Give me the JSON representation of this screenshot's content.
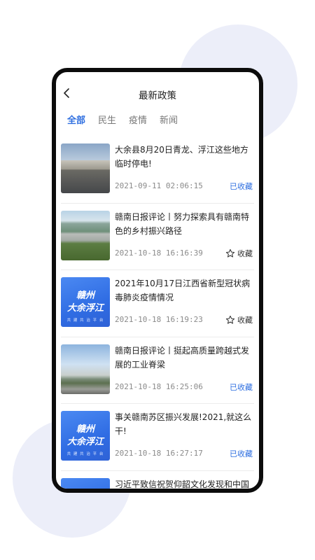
{
  "header": {
    "title": "最新政策"
  },
  "tabs": [
    {
      "label": "全部",
      "active": true
    },
    {
      "label": "民生",
      "active": false
    },
    {
      "label": "疫情",
      "active": false
    },
    {
      "label": "新闻",
      "active": false
    }
  ],
  "thumb_brand": {
    "line1": "赣州",
    "line2": "大余浮江",
    "sub": "共 建 共 治 平 台"
  },
  "articles": [
    {
      "title": "大余县8月20日青龙、浮江这些地方临时停电!",
      "date": "2021-09-11 02:06:15",
      "fav_label": "已收藏",
      "favorited": true
    },
    {
      "title": "赣南日报评论丨努力探索具有赣南特色的乡村振兴路径",
      "date": "2021-10-18 16:16:39",
      "fav_label": "收藏",
      "favorited": false
    },
    {
      "title": "2021年10月17日江西省新型冠状病毒肺炎疫情情况",
      "date": "2021-10-18 16:19:23",
      "fav_label": "收藏",
      "favorited": false
    },
    {
      "title": "赣南日报评论丨挺起高质量跨越式发展的工业脊梁",
      "date": "2021-10-18 16:25:06",
      "fav_label": "已收藏",
      "favorited": true
    },
    {
      "title": "事关赣南苏区振兴发展!2021,就这么干!",
      "date": "2021-10-18 16:27:17",
      "fav_label": "已收藏",
      "favorited": true
    },
    {
      "title": "习近平致信祝贺仰韶文化发现和中国"
    }
  ]
}
